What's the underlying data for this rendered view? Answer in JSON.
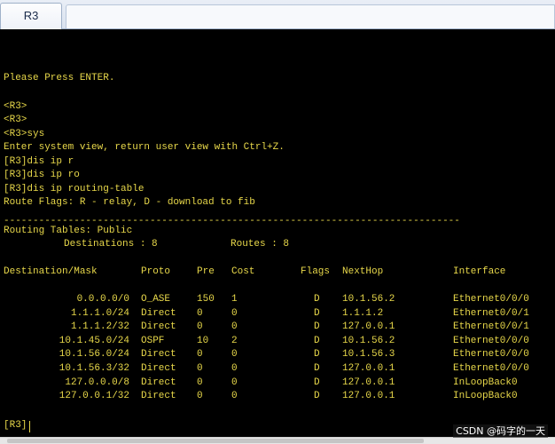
{
  "window": {
    "tab_title": "R3"
  },
  "terminal": {
    "lines": [
      "Please Press ENTER.",
      "",
      "<R3>",
      "<R3>",
      "<R3>sys",
      "Enter system view, return user view with Ctrl+Z.",
      "[R3]dis ip r",
      "[R3]dis ip ro",
      "[R3]dis ip routing-table",
      "Route Flags: R - relay, D - download to fib"
    ],
    "separator": "------------------------------------------------------------------------------",
    "routing_tables_line": "Routing Tables: Public",
    "summary": {
      "destinations_label": "Destinations : 8",
      "routes_label": "Routes : 8"
    },
    "table": {
      "headers": [
        "Destination/Mask",
        "Proto",
        "Pre",
        "Cost",
        "Flags",
        "NextHop",
        "Interface"
      ],
      "rows": [
        [
          "0.0.0.0/0",
          "O_ASE",
          "150",
          "1",
          "D",
          "10.1.56.2",
          "Ethernet0/0/0"
        ],
        [
          "1.1.1.0/24",
          "Direct",
          "0",
          "0",
          "D",
          "1.1.1.2",
          "Ethernet0/0/1"
        ],
        [
          "1.1.1.2/32",
          "Direct",
          "0",
          "0",
          "D",
          "127.0.0.1",
          "Ethernet0/0/1"
        ],
        [
          "10.1.45.0/24",
          "OSPF",
          "10",
          "2",
          "D",
          "10.1.56.2",
          "Ethernet0/0/0"
        ],
        [
          "10.1.56.0/24",
          "Direct",
          "0",
          "0",
          "D",
          "10.1.56.3",
          "Ethernet0/0/0"
        ],
        [
          "10.1.56.3/32",
          "Direct",
          "0",
          "0",
          "D",
          "127.0.0.1",
          "Ethernet0/0/0"
        ],
        [
          "127.0.0.0/8",
          "Direct",
          "0",
          "0",
          "D",
          "127.0.0.1",
          "InLoopBack0"
        ],
        [
          "127.0.0.1/32",
          "Direct",
          "0",
          "0",
          "D",
          "127.0.0.1",
          "InLoopBack0"
        ]
      ]
    },
    "prompt": "[R3]"
  },
  "watermark": "CSDN @码字的一天",
  "colors": {
    "terminal_bg": "#000000",
    "terminal_text": "#e8d84a"
  }
}
